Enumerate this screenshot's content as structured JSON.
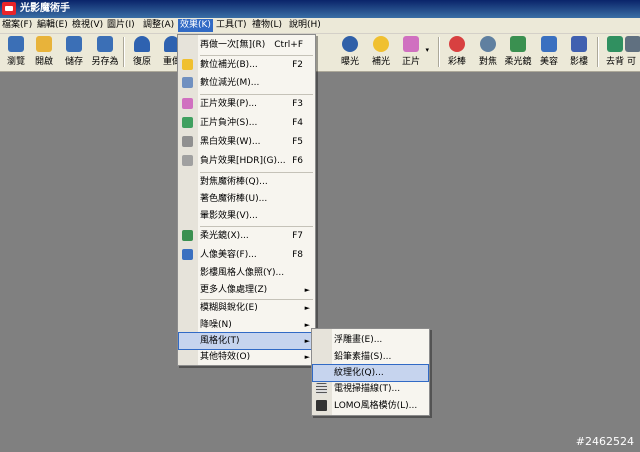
{
  "app": {
    "title": "光影魔術手"
  },
  "menubar": [
    {
      "label": "檔案(F)",
      "active": false
    },
    {
      "label": "編輯(E)",
      "active": false
    },
    {
      "label": "檢視(V)",
      "active": false
    },
    {
      "label": "圖片(I)",
      "active": false
    },
    {
      "label": "調整(A)",
      "active": false
    },
    {
      "label": "效果(K)",
      "active": true
    },
    {
      "label": "工具(T)",
      "active": false
    },
    {
      "label": "禮物(L)",
      "active": false
    },
    {
      "label": "說明(H)",
      "active": false
    }
  ],
  "toolbar": [
    {
      "label": "瀏覽",
      "icon": "browse-icon",
      "color": "#3b6fb6"
    },
    {
      "label": "開啟",
      "icon": "open-folder-icon",
      "color": "#e8b33a"
    },
    {
      "label": "儲存",
      "icon": "save-icon",
      "color": "#3b6fb6"
    },
    {
      "label": "另存為",
      "icon": "save-as-icon",
      "color": "#3b6fb6"
    },
    {
      "label": "復原",
      "icon": "undo-icon",
      "color": "#2e62b0"
    },
    {
      "label": "重做",
      "icon": "redo-icon",
      "color": "#2e62b0"
    },
    {
      "label": "曝光",
      "icon": "exposure-icon",
      "color": "#3060a8"
    },
    {
      "label": "補光",
      "icon": "fill-light-icon",
      "color": "#f0c030"
    },
    {
      "label": "正片",
      "icon": "slide-film-icon",
      "color": "#d070c0"
    },
    {
      "label": "彩棒",
      "icon": "color-stick-icon",
      "color": "#d84040"
    },
    {
      "label": "對焦",
      "icon": "focus-icon",
      "color": "#6080a0"
    },
    {
      "label": "柔光鏡",
      "icon": "soft-lens-icon",
      "color": "#3a9050"
    },
    {
      "label": "美容",
      "icon": "beauty-icon",
      "color": "#3a70c0"
    },
    {
      "label": "影樓",
      "icon": "studio-icon",
      "color": "#4060b0"
    },
    {
      "label": "去背",
      "icon": "remove-bg-icon",
      "color": "#309060"
    },
    {
      "label": "可",
      "icon": "more-icon",
      "color": "#607080"
    }
  ],
  "effects_menu": {
    "items": [
      {
        "label": "再做一次[無](R)",
        "shortcut": "Ctrl+F",
        "icon": "",
        "sub": false
      },
      {
        "label": "數位補光(B)...",
        "shortcut": "F2",
        "icon": "fill-light-icon",
        "sub": false
      },
      {
        "label": "數位減光(M)...",
        "shortcut": "",
        "icon": "reduce-light-icon",
        "sub": false
      },
      {
        "label": "正片效果(P)...",
        "shortcut": "F3",
        "icon": "slide-film-icon",
        "sub": false
      },
      {
        "label": "正片負沖(S)...",
        "shortcut": "F4",
        "icon": "cross-process-icon",
        "sub": false
      },
      {
        "label": "黑白效果(W)...",
        "shortcut": "F5",
        "icon": "bw-icon",
        "sub": false
      },
      {
        "label": "負片效果[HDR](G)...",
        "shortcut": "F6",
        "icon": "hdr-icon",
        "sub": false
      },
      {
        "label": "對焦魔術棒(Q)...",
        "shortcut": "",
        "icon": "",
        "sub": false
      },
      {
        "label": "著色魔術棒(U)...",
        "shortcut": "",
        "icon": "",
        "sub": false
      },
      {
        "label": "暈影效果(V)...",
        "shortcut": "",
        "icon": "",
        "sub": false
      },
      {
        "label": "柔光鏡(X)...",
        "shortcut": "F7",
        "icon": "soft-lens-icon",
        "sub": false
      },
      {
        "label": "人像美容(F)...",
        "shortcut": "F8",
        "icon": "beauty-icon",
        "sub": false
      },
      {
        "label": "影樓風格人像照(Y)...",
        "shortcut": "",
        "icon": "",
        "sub": false
      },
      {
        "label": "更多人像處理(Z)",
        "shortcut": "",
        "icon": "",
        "sub": true
      },
      {
        "label": "模糊與銳化(E)",
        "shortcut": "",
        "icon": "",
        "sub": true
      },
      {
        "label": "降噪(N)",
        "shortcut": "",
        "icon": "",
        "sub": true
      },
      {
        "label": "風格化(T)",
        "shortcut": "",
        "icon": "",
        "sub": true
      },
      {
        "label": "其他特效(O)",
        "shortcut": "",
        "icon": "",
        "sub": true
      }
    ]
  },
  "stylize_submenu": {
    "items": [
      {
        "label": "浮雕畫(E)...",
        "icon": ""
      },
      {
        "label": "鉛筆素描(S)...",
        "icon": ""
      },
      {
        "label": "紋理化(Q)...",
        "icon": ""
      },
      {
        "label": "電視掃描線(T)...",
        "icon": "scanline-icon"
      },
      {
        "label": "LOMO風格模仿(L)...",
        "icon": "lomo-icon"
      }
    ]
  },
  "watermark": "#2462524"
}
